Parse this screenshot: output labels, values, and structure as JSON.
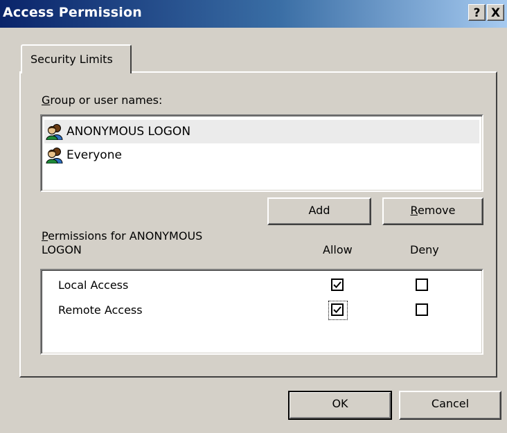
{
  "window": {
    "title": "Access Permission",
    "help_button": "?",
    "close_button": "X"
  },
  "tabs": [
    {
      "label": "Security Limits"
    }
  ],
  "group_label": "Group or user names:",
  "users": [
    {
      "name": "ANONYMOUS LOGON",
      "selected": true,
      "icon": "user-group-icon"
    },
    {
      "name": "Everyone",
      "selected": false,
      "icon": "user-group-icon"
    }
  ],
  "buttons": {
    "add": "Add",
    "remove": "Remove",
    "ok": "OK",
    "cancel": "Cancel"
  },
  "permissions": {
    "header_line1": "Permissions for ANONYMOUS",
    "header_line2": "LOGON",
    "allow_label": "Allow",
    "deny_label": "Deny",
    "rows": [
      {
        "name": "Local Access",
        "allow": true,
        "deny": false
      },
      {
        "name": "Remote Access",
        "allow": true,
        "deny": false
      }
    ]
  },
  "colors": {
    "title_start": "#0a246a",
    "title_end": "#a6caf0",
    "face": "#d4d0c8"
  }
}
